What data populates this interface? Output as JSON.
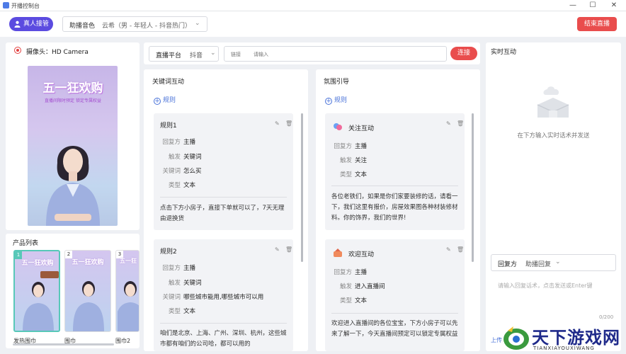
{
  "window": {
    "title": "开播控制台",
    "minimize": "—",
    "maximize": "☐",
    "close": "✕"
  },
  "toolbar": {
    "host_button": "真人接管",
    "voice_label": "助播音色",
    "voice_value": "云希（男 - 年轻人 - 抖音热门）",
    "end_button": "结束直播"
  },
  "camera": {
    "title": "摄像头：HD Camera"
  },
  "preview": {
    "banner": "五一狂欢购",
    "subtitle": "直播间限时预定 锁定专属权益"
  },
  "products": {
    "title": "产品列表",
    "items": [
      {
        "num": "1",
        "name": "发热围巾",
        "banner": "五一狂欢购"
      },
      {
        "num": "2",
        "name": "围巾",
        "banner": "五一狂欢购"
      },
      {
        "num": "3",
        "name": "围巾2",
        "banner": "五一狂"
      }
    ]
  },
  "stream": {
    "platform_label": "直播平台",
    "platform_value": "抖音",
    "link_label": "链接",
    "link_placeholder": "请输入",
    "connect_button": "连接"
  },
  "keyword": {
    "title": "关键词互动",
    "add_rule": "规则",
    "labels": {
      "reply": "回复方",
      "trigger": "触发",
      "keyword": "关键词",
      "type": "类型"
    },
    "rules": [
      {
        "title": "规则1",
        "reply": "主播",
        "trigger": "关键词",
        "keyword": "怎么买",
        "type": "文本",
        "content": "点击下方小房子，直接下单就可以了，7天无理由退换货"
      },
      {
        "title": "规则2",
        "reply": "主播",
        "trigger": "关键词",
        "keyword": "哪些城市能用,哪些城市可以用",
        "type": "文本",
        "content": "咱们是北京、上海、广州、深圳、杭州，这些城市都有咱们的公司哈，都可以用的"
      }
    ]
  },
  "atmosphere": {
    "title": "氛围引导",
    "add_rule": "规则",
    "labels": {
      "reply": "回复方",
      "trigger": "触发",
      "type": "类型"
    },
    "rules": [
      {
        "title": "关注互动",
        "reply": "主播",
        "trigger": "关注",
        "type": "文本",
        "content": "各位老铁们，如果是你们家要装修的话，请看一下，我们这里有报价，房屋效果图各种材装修材料。你的饰界，我们的世界!"
      },
      {
        "title": "欢迎互动",
        "reply": "主播",
        "trigger": "进入直播间",
        "type": "文本",
        "content": "欢迎进入直播间的各位宝宝，下方小房子可以先来了解一下，今天直播间预定可以锁定专属权益"
      }
    ]
  },
  "realtime": {
    "title": "实时互动",
    "empty_text": "在下方输入实时话术并发送",
    "reply_label": "回复方",
    "reply_value": "助播回复",
    "input_placeholder": "请输入回复话术，点击发送或Enter键",
    "counter": "0/200",
    "upload": "上传"
  },
  "watermark": {
    "title": "天下游戏网",
    "sub": "TIANXIAYOUXIWANG"
  },
  "colors": {
    "accent": "#5b4be0",
    "danger": "#e94d4d",
    "link": "#4a73d9"
  }
}
